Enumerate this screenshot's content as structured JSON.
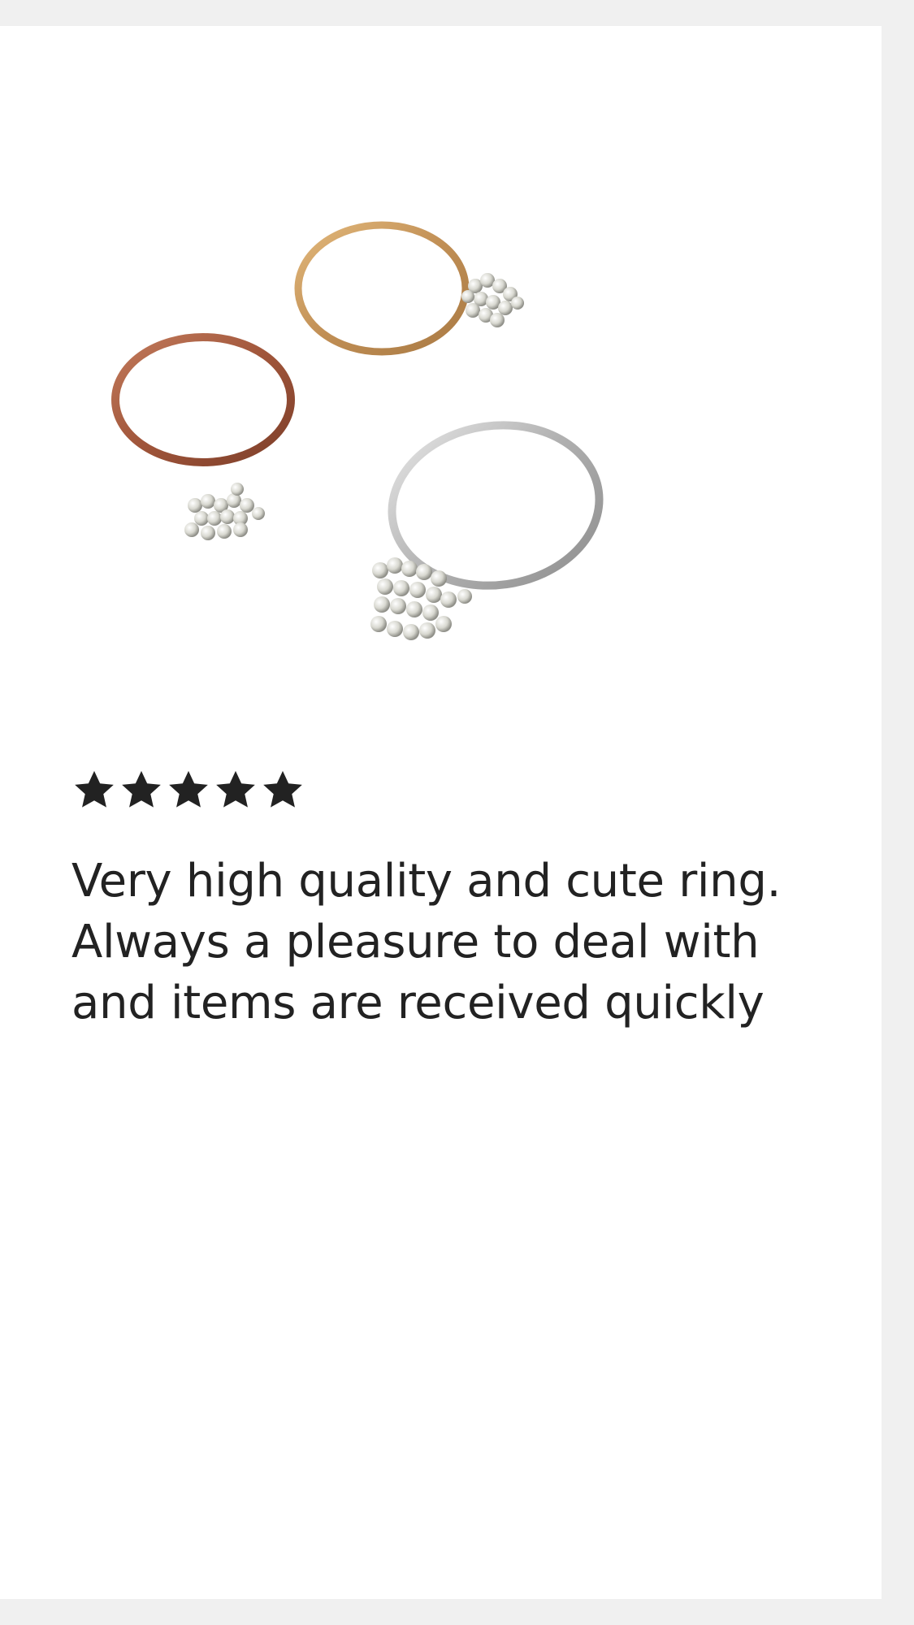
{
  "review": {
    "rating": 5,
    "rating_max": 5,
    "text": "Very high quality and cute ring. Always a pleasure to deal with and items are received quickly"
  },
  "photo": {
    "subject": "three stacking rings with silver bead clusters: copper, gold, silver",
    "colors": {
      "copper": "#a0553a",
      "gold": "#c99a5b",
      "silver": "#b8b8b8"
    }
  },
  "theme": {
    "page_bg": "#f0f0f0",
    "card_bg": "#ffffff",
    "star_color": "#222222",
    "text_color": "#222222"
  }
}
